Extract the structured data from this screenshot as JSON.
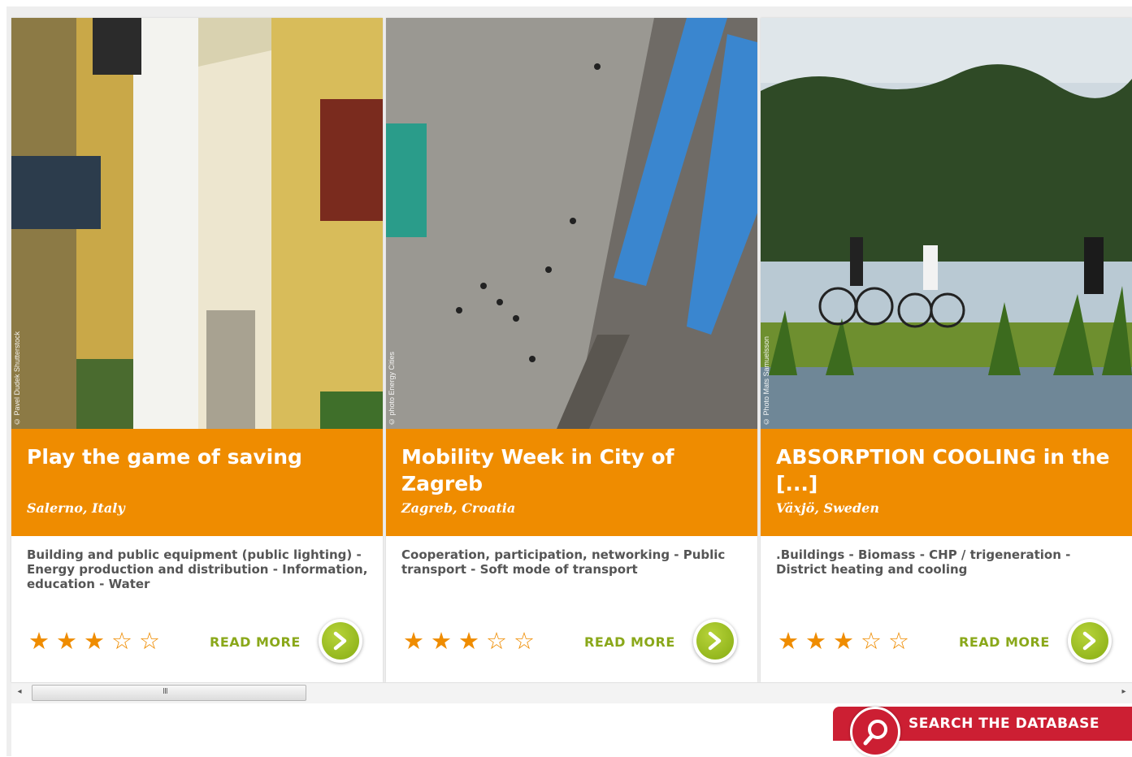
{
  "cards": [
    {
      "title": "Play the game of saving",
      "location": "Salerno, Italy",
      "tags": "Building and public equipment (public lighting) - Energy production and distribution - Information, education - Water",
      "credit": "© Pavel Dudek Shutterstock",
      "rating": 3,
      "rating_max": 5,
      "stars": [
        "★",
        "★",
        "★",
        "☆",
        "☆"
      ],
      "read_more": "READ MORE"
    },
    {
      "title": "Mobility Week in City of Zagreb",
      "location": "Zagreb, Croatia",
      "tags": "Cooperation, participation, networking - Public transport - Soft mode of transport",
      "credit": "© photo Energy Cities",
      "rating": 3,
      "rating_max": 5,
      "stars": [
        "★",
        "★",
        "★",
        "☆",
        "☆"
      ],
      "read_more": "READ MORE"
    },
    {
      "title": "ABSORPTION COOLING in the [...]",
      "location": "Växjö, Sweden",
      "tags": ".Buildings - Biomass - CHP / trigeneration - District heating and cooling",
      "credit": "© Photo Mats Samuelsson",
      "rating": 3,
      "rating_max": 5,
      "stars": [
        "★",
        "★",
        "★",
        "☆",
        "☆"
      ],
      "read_more": "READ MORE"
    }
  ],
  "scrollbar": {
    "grip": "III"
  },
  "search": {
    "label": "SEARCH THE DATABASE"
  },
  "colors": {
    "orange": "#ef8c00",
    "green": "#8aa81a",
    "red": "#cc1f33"
  },
  "icons": {
    "go": "chevron-right-icon",
    "search": "magnifier-icon"
  }
}
